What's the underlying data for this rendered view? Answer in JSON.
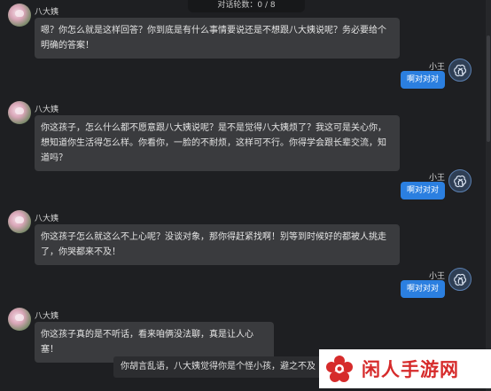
{
  "header": {
    "counter": "对话轮数：0 / 8"
  },
  "messages": [
    {
      "sender": "八大姨",
      "side": "left",
      "text": "嗯？你怎么就是这样回答？你到底是有什么事情要说还是不想跟八大姨说呢？务必要给个明确的答案！"
    },
    {
      "sender": "小王",
      "side": "right",
      "text": "啊对对对"
    },
    {
      "sender": "八大姨",
      "side": "left",
      "text": "你这孩子，怎么什么都不愿意跟八大姨说呢？是不是觉得八大姨烦了？我这可是关心你，想知道你生活得怎么样。你看你，一脸的不耐烦，这样可不行。你得学会跟长辈交流，知道吗？"
    },
    {
      "sender": "小王",
      "side": "right",
      "text": "啊对对对"
    },
    {
      "sender": "八大姨",
      "side": "left",
      "text": "你这孩子怎么就这么不上心呢？没谈对象，那你得赶紧找啊！别等到时候好的都被人挑走了，你哭都来不及！"
    },
    {
      "sender": "小王",
      "side": "right",
      "text": "啊对对对"
    },
    {
      "sender": "八大姨",
      "side": "left",
      "text": "你这孩子真的是不听话，看来咱俩没法聊，真是让人心塞！"
    }
  ],
  "input": {
    "value": "你胡言乱语，八大姨觉得你是个怪小孩，避之不及"
  },
  "watermark": {
    "text": "闲人手游网"
  },
  "colors": {
    "background": "#1e1f22",
    "bubble_left": "#3a3b3e",
    "bubble_right": "#2b7fe0",
    "watermark_red": "#d62b2b"
  },
  "icons": {
    "aunt_avatar": "flower-avatar-icon",
    "user_avatar": "openai-logo-icon"
  }
}
